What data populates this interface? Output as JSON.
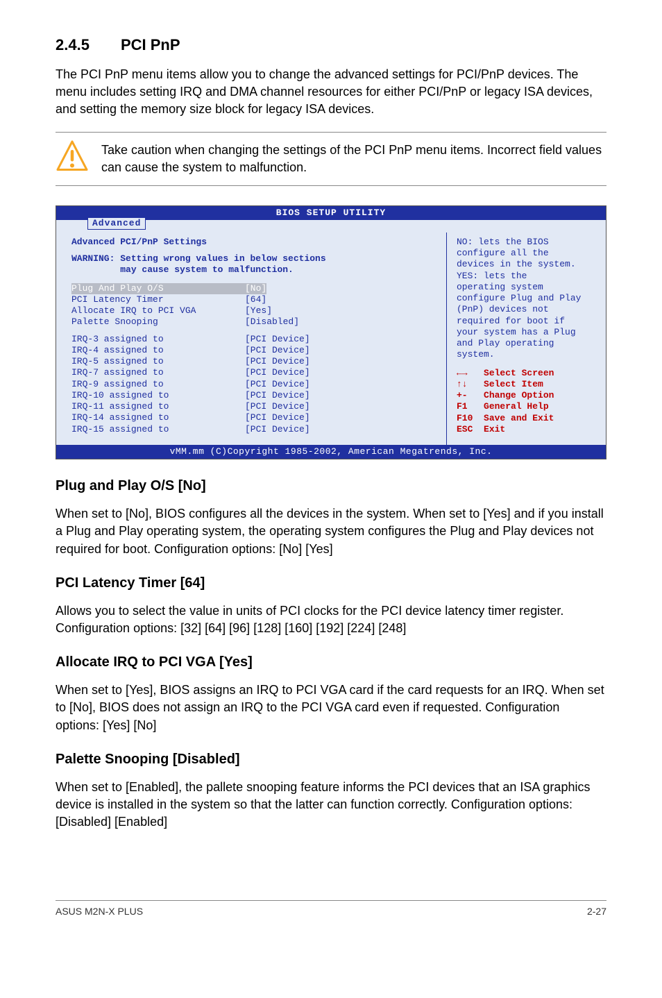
{
  "section": {
    "number": "2.4.5",
    "title": "PCI PnP",
    "intro": "The PCI PnP menu items allow you to change the advanced settings for PCI/PnP devices. The menu includes setting IRQ and DMA channel resources for either PCI/PnP or legacy ISA devices, and setting the memory size block for legacy ISA devices."
  },
  "caution": {
    "text": "Take caution when changing the settings of the PCI PnP menu items. Incorrect field values can cause the system to malfunction."
  },
  "bios": {
    "title": "BIOS SETUP UTILITY",
    "tab": "Advanced",
    "heading": "Advanced PCI/PnP Settings",
    "warning": "WARNING: Setting wrong values in below sections\n         may cause system to malfunction.",
    "rows": [
      {
        "label": "Plug And Play O/S",
        "value": "[No]",
        "selected": true
      },
      {
        "label": "PCI Latency Timer",
        "value": "[64]",
        "selected": false
      },
      {
        "label": "Allocate IRQ to PCI VGA",
        "value": "[Yes]",
        "selected": false
      },
      {
        "label": "Palette Snooping",
        "value": "[Disabled]",
        "selected": false
      }
    ],
    "irqs": [
      {
        "label": "IRQ-3 assigned to",
        "value": "[PCI Device]"
      },
      {
        "label": "IRQ-4 assigned to",
        "value": "[PCI Device]"
      },
      {
        "label": "IRQ-5 assigned to",
        "value": "[PCI Device]"
      },
      {
        "label": "IRQ-7 assigned to",
        "value": "[PCI Device]"
      },
      {
        "label": "IRQ-9 assigned to",
        "value": "[PCI Device]"
      },
      {
        "label": "IRQ-10 assigned to",
        "value": "[PCI Device]"
      },
      {
        "label": "IRQ-11 assigned to",
        "value": "[PCI Device]"
      },
      {
        "label": "IRQ-14 assigned to",
        "value": "[PCI Device]"
      },
      {
        "label": "IRQ-15 assigned to",
        "value": "[PCI Device]"
      }
    ],
    "help": "NO: lets the BIOS\nconfigure all the\ndevices in the system.\nYES: lets the\noperating system\nconfigure Plug and Play\n(PnP) devices not\nrequired for boot if\nyour system has a Plug\nand Play operating\nsystem.",
    "keys": [
      {
        "sym": "←→",
        "txt": "Select Screen"
      },
      {
        "sym": "↑↓",
        "txt": "Select Item"
      },
      {
        "sym": "+-",
        "txt": "Change Option"
      },
      {
        "sym": "F1",
        "txt": "General Help"
      },
      {
        "sym": "F10",
        "txt": "Save and Exit"
      },
      {
        "sym": "ESC",
        "txt": "Exit"
      }
    ],
    "footer": "vMM.mm (C)Copyright 1985-2002, American Megatrends, Inc."
  },
  "subsections": [
    {
      "title": "Plug and Play O/S [No]",
      "body": "When set to [No], BIOS configures all the devices in the system. When set to [Yes] and if you install a Plug and Play operating system, the operating system configures the Plug and Play devices not required for boot. Configuration options: [No] [Yes]"
    },
    {
      "title": "PCI Latency Timer [64]",
      "body": "Allows you to select the value in units of PCI clocks for the PCI device latency timer register. Configuration options: [32] [64] [96] [128] [160] [192] [224] [248]"
    },
    {
      "title": "Allocate IRQ to PCI VGA [Yes]",
      "body": "When set to [Yes], BIOS assigns an IRQ to PCI VGA card if the card requests for an IRQ. When set to [No], BIOS does not assign an IRQ to the PCI VGA card even if requested. Configuration options: [Yes] [No]"
    },
    {
      "title": "Palette Snooping [Disabled]",
      "body": "When set to [Enabled], the pallete snooping feature informs the PCI devices that an ISA graphics device is installed in the system so that the latter can function correctly. Configuration options: [Disabled] [Enabled]"
    }
  ],
  "footer": {
    "left": "ASUS M2N-X PLUS",
    "right": "2-27"
  }
}
